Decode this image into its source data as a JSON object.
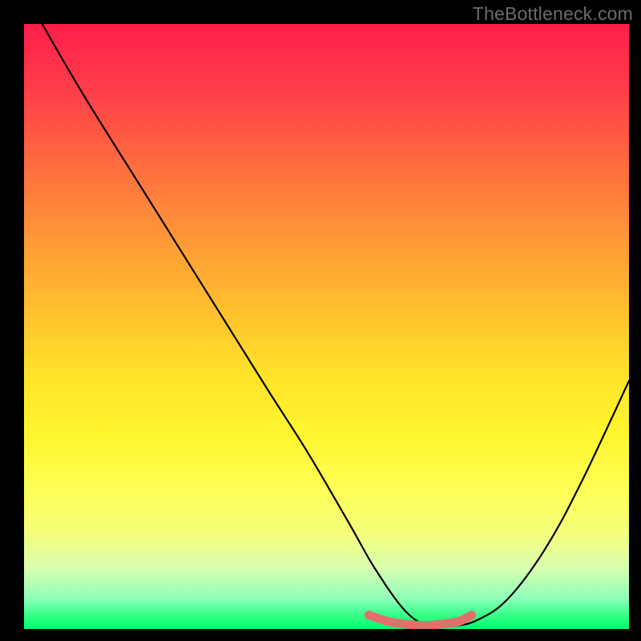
{
  "watermark": "TheBottleneck.com",
  "chart_data": {
    "type": "line",
    "title": "",
    "xlabel": "",
    "ylabel": "",
    "ylim": [
      0,
      100
    ],
    "xlim": [
      0,
      100
    ],
    "series": [
      {
        "name": "bottleneck-curve",
        "x": [
          3,
          10,
          20,
          30,
          40,
          47,
          54,
          58,
          63,
          67,
          71,
          75,
          80,
          86,
          92,
          100
        ],
        "values": [
          100,
          88,
          72,
          56,
          40,
          29,
          17,
          10,
          3,
          0.5,
          0.5,
          1.5,
          5,
          13,
          24,
          41
        ]
      },
      {
        "name": "optimal-zone",
        "x": [
          57,
          60,
          63,
          66,
          69,
          72,
          74
        ],
        "values": [
          2.3,
          1.3,
          0.8,
          0.6,
          0.8,
          1.3,
          2.3
        ]
      }
    ],
    "colors": {
      "curve": "#000000",
      "optimal": "#e2706a",
      "background_top": "#ff1f4a",
      "background_bottom": "#00ff75"
    }
  }
}
